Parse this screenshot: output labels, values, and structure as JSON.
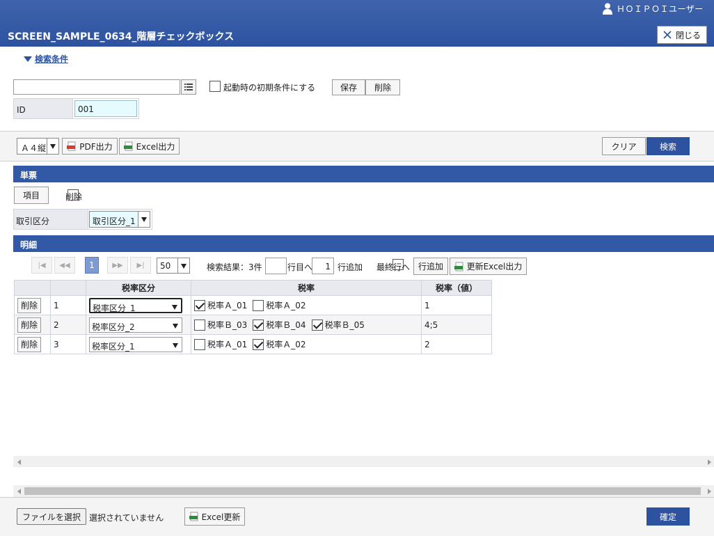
{
  "header": {
    "user_name": "ＨＯＩＰＯＩユーザー",
    "title": "SCREEN_SAMPLE_0634_階層チェックボックス",
    "close_label": "閉じる"
  },
  "search": {
    "toggle_label": "検索条件",
    "condition_value": "",
    "startup_label": "起動時の初期条件にする",
    "save_label": "保存",
    "delete_label": "削除",
    "id_label": "ID",
    "id_value": "001"
  },
  "toolbar": {
    "paper_size": "Ａ４縦",
    "pdf_label": "PDF出力",
    "excel_label": "Excel出力",
    "clear_label": "クリア",
    "search_label": "検索"
  },
  "single": {
    "section_title": "単票",
    "item_label": "項目",
    "delete_label": "削除",
    "trade_label": "取引区分",
    "trade_value": "取引区分_1"
  },
  "detail": {
    "section_title": "明細",
    "pager": {
      "first": "|◀",
      "prev": "◀◀",
      "current_page": "1",
      "next": "▶▶",
      "last": "▶|",
      "per_page": "50",
      "result_label": "検索結果：3件",
      "row_no_value": "",
      "row_to_label": "行目へ",
      "row_count_value": "1",
      "row_add_label": "行追加",
      "last_row_label": "最終行へ",
      "add_row_label": "行追加",
      "update_excel_label": "更新Excel出力"
    },
    "columns": [
      "",
      "",
      "税率区分",
      "税率",
      "税率（値）"
    ],
    "delete_label": "削除",
    "rows": [
      {
        "no": "1",
        "category": "税率区分_1",
        "options": [
          {
            "label": "税率Ａ_01",
            "checked": true
          },
          {
            "label": "税率Ａ_02",
            "checked": false
          }
        ],
        "value": "1"
      },
      {
        "no": "2",
        "category": "税率区分_2",
        "options": [
          {
            "label": "税率Ｂ_03",
            "checked": false
          },
          {
            "label": "税率Ｂ_04",
            "checked": true
          },
          {
            "label": "税率Ｂ_05",
            "checked": true
          }
        ],
        "value": "4;5"
      },
      {
        "no": "3",
        "category": "税率区分_1",
        "options": [
          {
            "label": "税率Ａ_01",
            "checked": false
          },
          {
            "label": "税率Ａ_02",
            "checked": true
          }
        ],
        "value": "2"
      }
    ]
  },
  "footer": {
    "file_button": "ファイルを選択",
    "file_status": "選択されていません",
    "excel_update_label": "Excel更新",
    "confirm_label": "確定"
  },
  "colors": {
    "header_blue": "#2d52a0",
    "section_blue": "#3159a6",
    "input_highlight": "#e6fbff",
    "pager_active": "#7d9ad3"
  }
}
